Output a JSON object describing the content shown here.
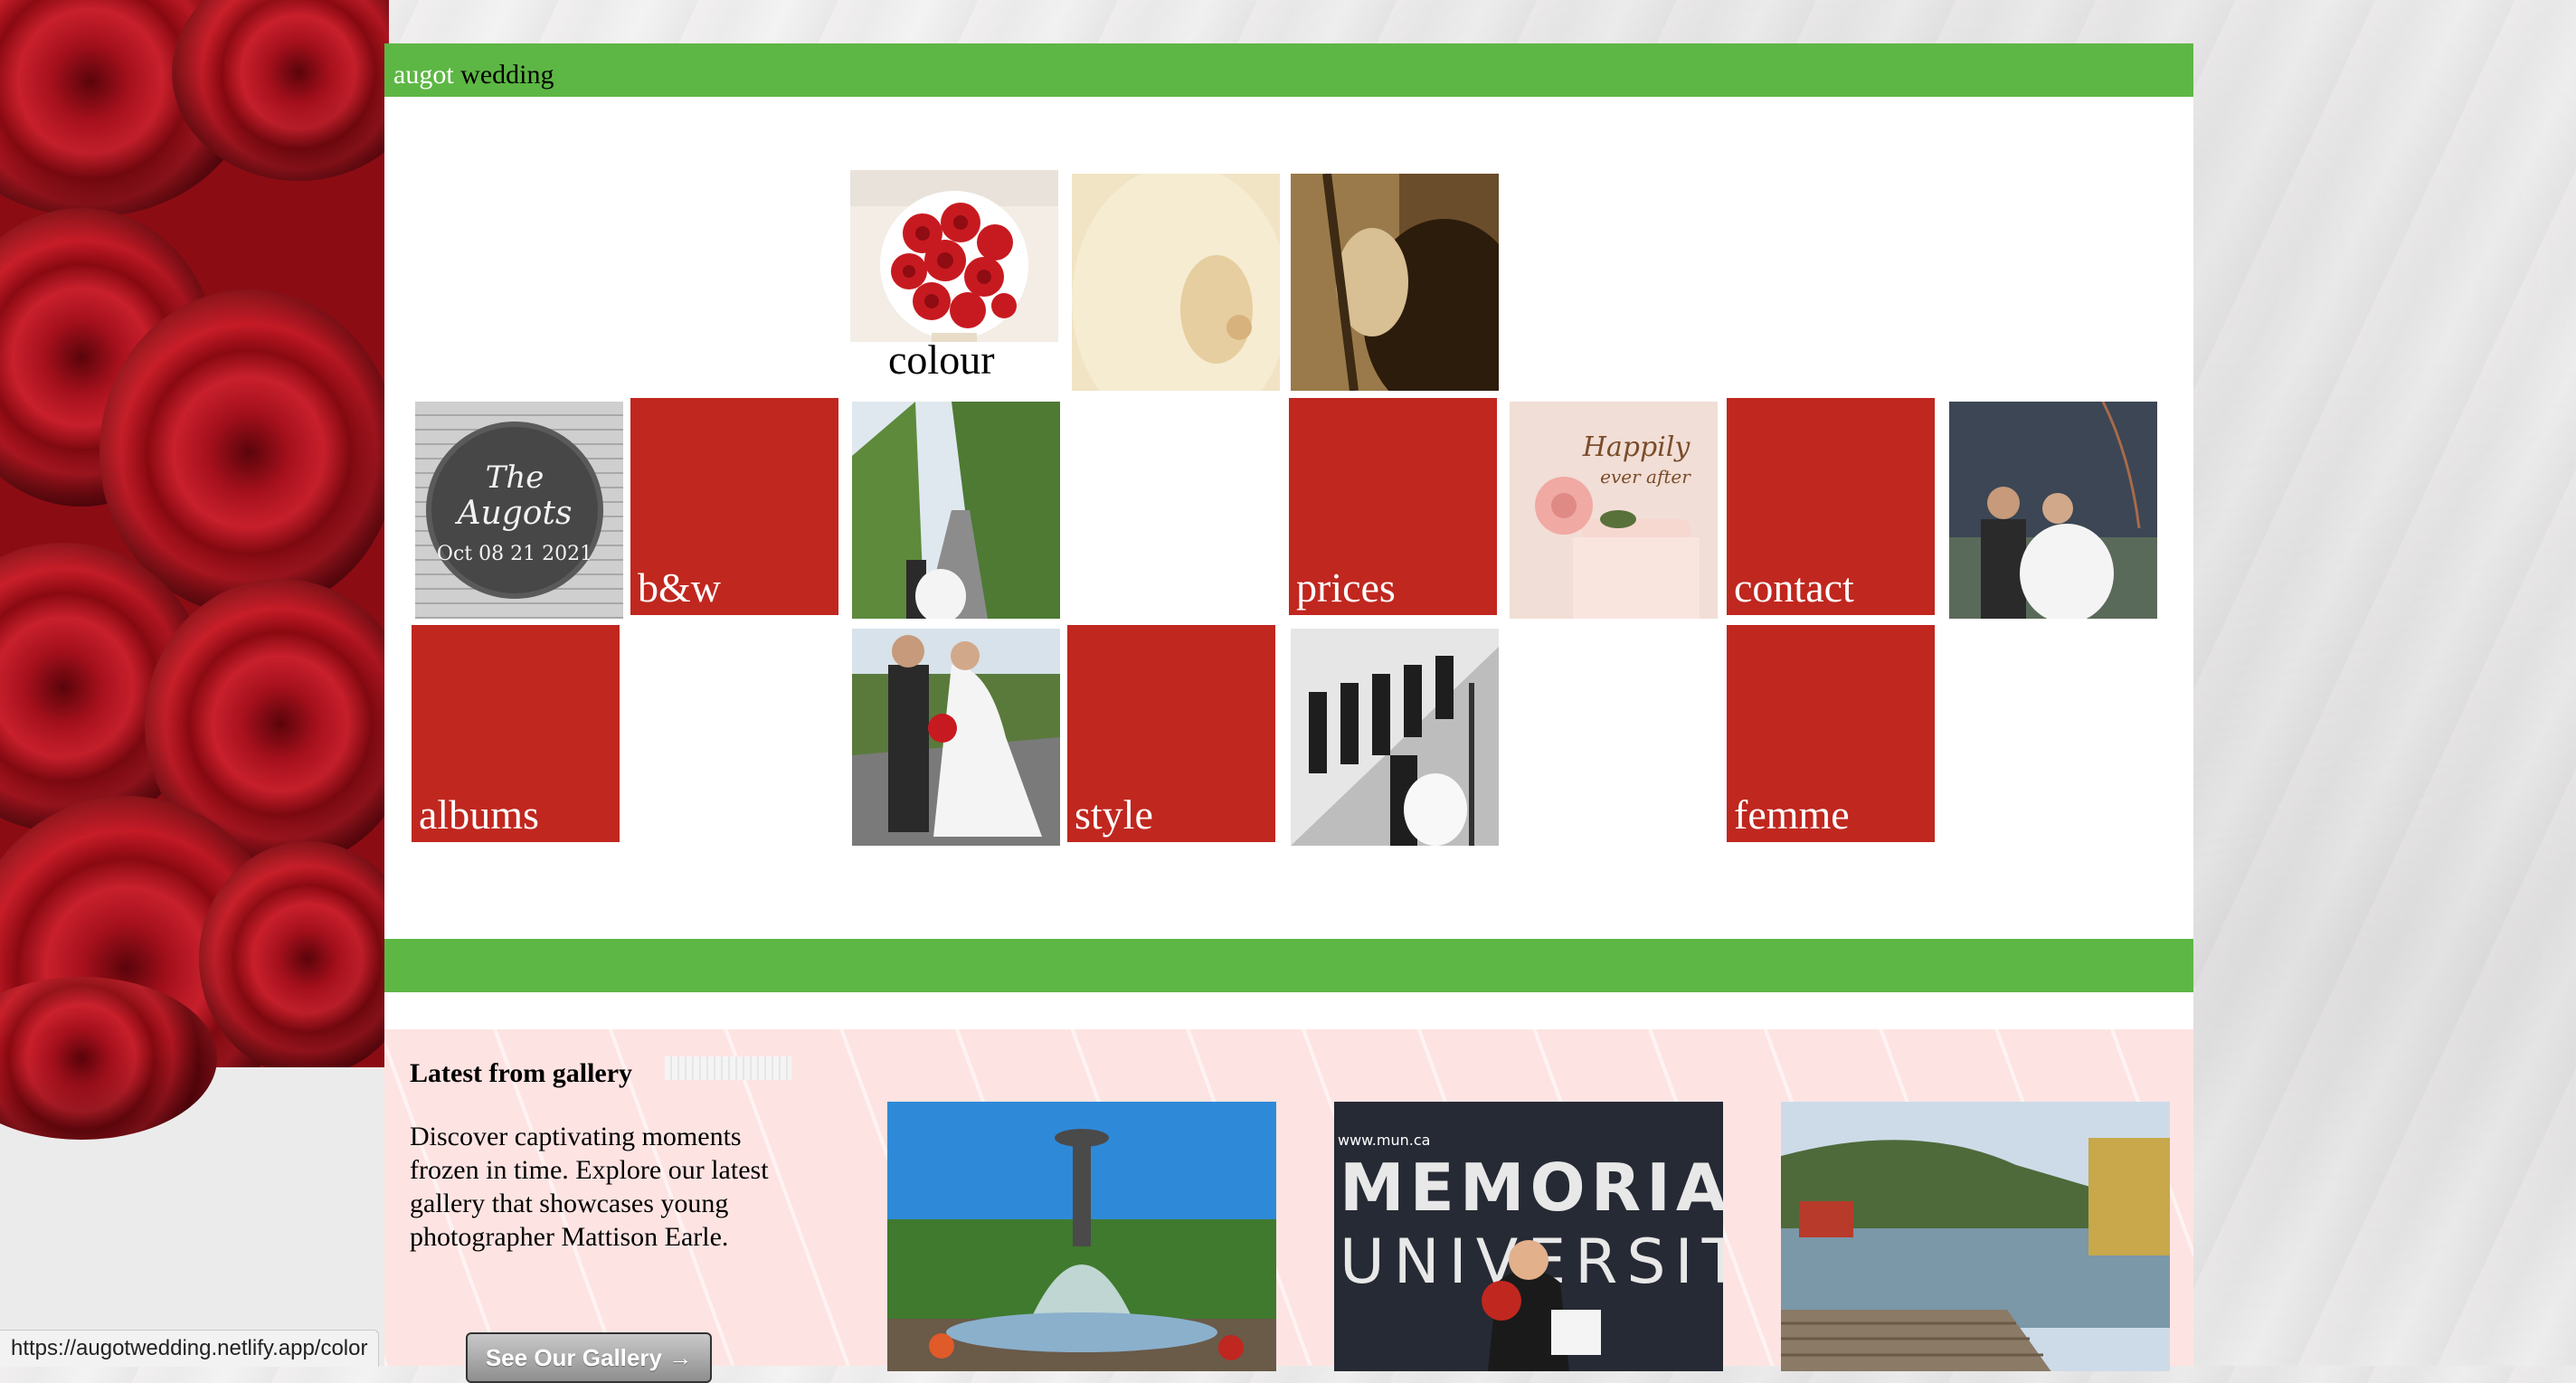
{
  "brand": {
    "first": "augot",
    "second": " wedding"
  },
  "tiles": {
    "colour": "colour",
    "bw": "b&w",
    "prices": "prices",
    "contact": "contact",
    "albums": "albums",
    "style": "style",
    "femme": "femme"
  },
  "gallery": {
    "title": "Latest from gallery",
    "description": "Discover captivating moments frozen in time. Explore our latest gallery that showcases young photographer Mattison Earle.",
    "button": "See Our Gallery →"
  },
  "status_url": "https://augotwedding.netlify.app/color",
  "colors": {
    "green": "#5db744",
    "red": "#c0271f",
    "gallery_bg": "#fde4e2"
  }
}
